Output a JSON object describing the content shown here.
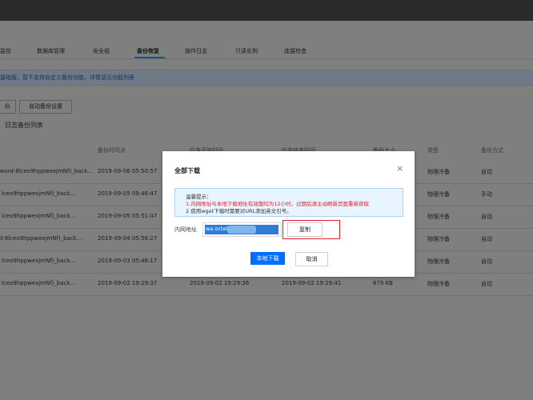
{
  "header": {
    "instance_title": ")"
  },
  "tabs": [
    {
      "label": "监控"
    },
    {
      "label": "数据库管理"
    },
    {
      "label": "安全组"
    },
    {
      "label": "备份恢复",
      "active": true
    },
    {
      "label": "操作日志"
    },
    {
      "label": "只读实例"
    },
    {
      "label": "连接检查"
    }
  ],
  "notice": {
    "text": "基础版，暂不支持自定义备份功能，详情请见功能列表"
  },
  "toolbar": {
    "backup_btn": "份",
    "auto_backup_btn": "自动备份设置"
  },
  "section": {
    "title": "日志备份列表"
  },
  "table": {
    "headers": [
      "",
      "备份时间点",
      "任务开始时间",
      "任务结束时间",
      "备份大小",
      "类型",
      "备份方式"
    ],
    "rows": [
      {
        "name": "sword-8lceo9hppwexjmNf)_back...",
        "time": "2019-09-06 05:50:57",
        "start": "",
        "end": "",
        "size": "",
        "type": "物理冷备",
        "mode": "自动"
      },
      {
        "name": "lceo9hppwexjmNf)_back...",
        "time": "2019-09-05 09:46:47",
        "start": "",
        "end": "",
        "size": "",
        "type": "物理冷备",
        "mode": "手动"
      },
      {
        "name": "lceo9hppwexjmNf)_back...",
        "time": "2019-09-05 05:51:47",
        "start": "",
        "end": "",
        "size": "",
        "type": "物理冷备",
        "mode": "自动"
      },
      {
        "name": "rd-8lceo9hppwexjmNf)_back...",
        "time": "2019-09-04 05:56:27",
        "start": "",
        "end": "",
        "size": "",
        "type": "物理冷备",
        "mode": "自动"
      },
      {
        "name": "lceo9hppwexjmNf)_back...",
        "time": "2019-09-03 05:46:17",
        "start": "",
        "end": "",
        "size": "",
        "type": "物理冷备",
        "mode": "自动"
      },
      {
        "name": "lceo9hppwexjmNf)_back...",
        "time": "2019-09-02 19:29:37",
        "start": "2019-09-02 19:29:36",
        "end": "2019-09-02 19:29:41",
        "size": "679 KB",
        "type": "物理冷备",
        "mode": "自动"
      }
    ]
  },
  "modal": {
    "title": "全部下载",
    "close_icon": "×",
    "tip_title": "温馨提示：",
    "tip_line1": "1.内网地址与本地下载地址有效期均为12小时，过期后请主动刷新页面重新获取",
    "tip_line2": "2.使用wget下载时需要对URL添加英文引号。",
    "addr_label": "内网地址",
    "addr_value": "wa               octet-stream",
    "copy_btn": "复制",
    "download_btn": "本地下载",
    "cancel_btn": "取消"
  },
  "colors": {
    "primary": "#006eff",
    "highlight": "#e0202a",
    "tip_bg": "#e8f4ff"
  }
}
